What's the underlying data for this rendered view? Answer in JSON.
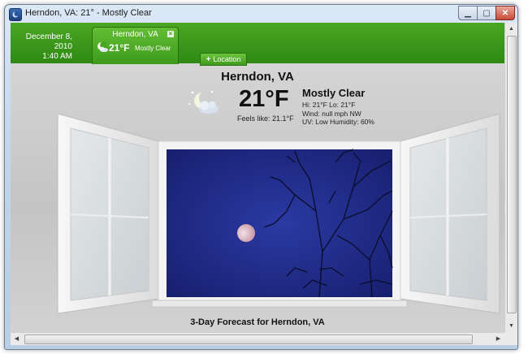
{
  "window": {
    "title": "Herndon, VA: 21° - Mostly Clear"
  },
  "tabbar": {
    "date": "December 8, 2010",
    "time": "1:40 AM",
    "location_tab": {
      "city": "Herndon, VA",
      "temp": "21°F",
      "condition": "Mostly Clear",
      "close_glyph": "×"
    },
    "add_location": {
      "plus": "+",
      "label": "Location"
    }
  },
  "current": {
    "city": "Herndon, VA",
    "temp": "21°F",
    "feels_like": "Feels like:  21.1°F",
    "condition": "Mostly Clear",
    "hi_lo": "Hi: 21°F Lo: 21°F",
    "wind": "Wind: null mph NW",
    "uv_humidity": "UV: Low Humidity: 60%"
  },
  "forecast": {
    "title": "3-Day Forecast for Herndon, VA"
  },
  "colors": {
    "green_bar": "#3a9a1a",
    "sky": "#1f2a86"
  },
  "icons": [
    "app-icon",
    "minimize-icon",
    "maximize-icon",
    "close-icon",
    "moon-cloud-icon",
    "plus-icon",
    "scroll-arrow-icon"
  ]
}
